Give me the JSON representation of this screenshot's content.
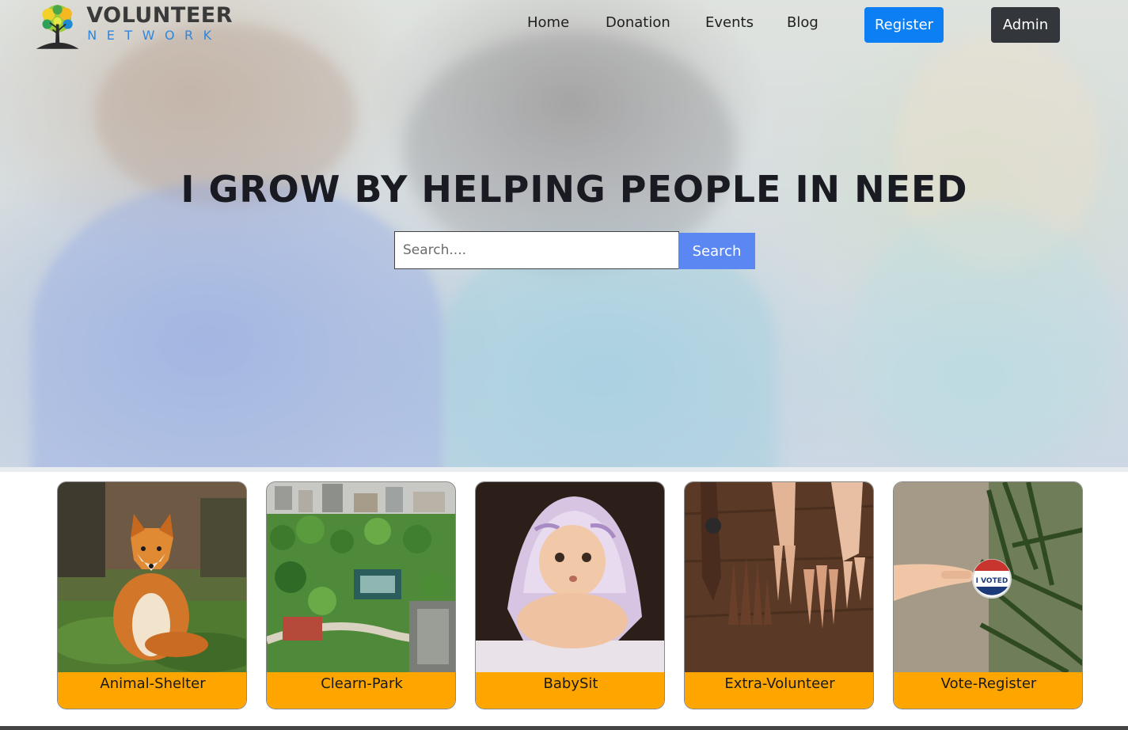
{
  "brand": {
    "name": "VOLUNTEER",
    "tagline": "NETWORK",
    "colors": {
      "name": "#3a3a3a",
      "tagline": "#2e86de"
    }
  },
  "nav": {
    "links": [
      "Home",
      "Donation",
      "Events",
      "Blog"
    ],
    "register_label": "Register",
    "admin_label": "Admin"
  },
  "hero": {
    "headline": "I GROW BY HELPING PEOPLE IN NEED",
    "search": {
      "value": "",
      "placeholder": "Search....",
      "button_label": "Search"
    }
  },
  "categories": [
    {
      "label": "Animal-Shelter",
      "icon": "fox-photo"
    },
    {
      "label": "Clearn-Park",
      "icon": "park-aerial-photo"
    },
    {
      "label": "BabySit",
      "icon": "baby-photo"
    },
    {
      "label": "Extra-Volunteer",
      "icon": "hands-photo"
    },
    {
      "label": "Vote-Register",
      "icon": "i-voted-sticker-photo"
    }
  ],
  "colors": {
    "register": "#0d7ff5",
    "admin": "#33363b",
    "search_button": "#5b87f2",
    "card_label": "#ffa500"
  }
}
